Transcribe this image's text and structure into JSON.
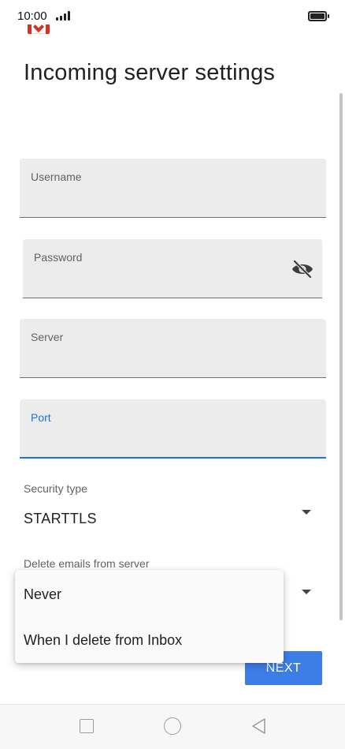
{
  "status_bar": {
    "time": "10:00",
    "signal_icon": "signal-bars-icon",
    "battery_icon": "battery-full-icon"
  },
  "app": {
    "logo_icon": "gmail-logo-icon",
    "title": "Incoming server settings"
  },
  "form": {
    "username": {
      "label": "Username",
      "value": ""
    },
    "password": {
      "label": "Password",
      "value": "",
      "toggle_icon": "eye-off-icon"
    },
    "server": {
      "label": "Server",
      "value": ""
    },
    "port": {
      "label": "Port",
      "value": ""
    },
    "security_type": {
      "label": "Security type",
      "value": "STARTTLS"
    },
    "delete_emails": {
      "label": "Delete emails from server",
      "options": [
        "Never",
        "When I delete from Inbox"
      ]
    }
  },
  "actions": {
    "next_label": "NEXT"
  },
  "navigation": {
    "recent_icon": "square-recents-icon",
    "home_icon": "circle-home-icon",
    "back_icon": "triangle-back-icon"
  },
  "colors": {
    "accent": "#1a73e8",
    "button": "#3d7de8",
    "field_bg": "#ececec",
    "gmail_red": "#d93025"
  }
}
